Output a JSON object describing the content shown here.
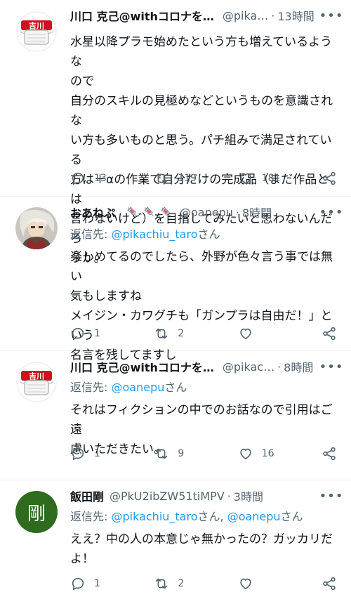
{
  "tweets": [
    {
      "name": "川口 克己@withコロナを…",
      "handle": "@pika…",
      "time": "13時間",
      "reply_prefix": "",
      "reply_mentions": [],
      "body": [
        "水星以降プラモ始めたという方も増えているような",
        "ので",
        "自分のスキルの見極めなどというものを意識されな",
        "い方も多いものと思う。パチ組みで満足されている",
        "方は＋αの作業で自分だけの完成品（まだ作品とは",
        "言わないけど）を目指してみたいと思わないんだろ",
        "うか。"
      ],
      "replies": "13",
      "retweets": "119",
      "likes": "181",
      "avatar": "badge-avatar"
    },
    {
      "name": "おあねぷ",
      "handle": "@oanepu",
      "time": "8時間",
      "reply_prefix": "返信先: ",
      "reply_mentions": [
        "@pikachiu_taro"
      ],
      "reply_suffix": "さん",
      "body": [
        "楽しめてるのでしたら、外野が色々言う事では無い",
        "気もしますね",
        "メイジン・カワグチも「ガンプラは自由だ！」という",
        "名言を残してますし"
      ],
      "replies": "1",
      "retweets": "2",
      "likes": "",
      "avatar": "character-avatar"
    },
    {
      "name": "川口 克己@withコロナを…",
      "handle": "@pikac…",
      "time": "8時間",
      "reply_prefix": "返信先: ",
      "reply_mentions": [
        "@oanepu"
      ],
      "reply_suffix": "さん",
      "body": [
        "それはフィクションの中でのお話なので引用はご遠",
        "慮いただきたい。"
      ],
      "replies": "1",
      "retweets": "9",
      "likes": "16",
      "avatar": "badge-avatar"
    },
    {
      "name": "飯田剛",
      "handle": "@PkU2ibZW51tiMPV",
      "time": "3時間",
      "reply_prefix": "返信先: ",
      "reply_mentions": [
        "@pikachiu_taro",
        "@oanepu"
      ],
      "reply_suffix": "さん",
      "body": [
        "ええ？中の人の本意じゃ無かったの？ガッカリだ",
        "よ！"
      ],
      "replies": "1",
      "retweets": "2",
      "likes": "",
      "avatar_letter": "剛",
      "avatar": "letter-avatar"
    }
  ],
  "colors": {
    "accent": "#1d9bf0",
    "muted": "#536471",
    "text": "#0f1419",
    "green_avatar": "#2f6b1f",
    "badge_red": "#d0101e"
  },
  "icons": [
    "reply-icon",
    "retweet-icon",
    "like-icon",
    "share-icon",
    "more-icon",
    "syringe-emoji"
  ]
}
